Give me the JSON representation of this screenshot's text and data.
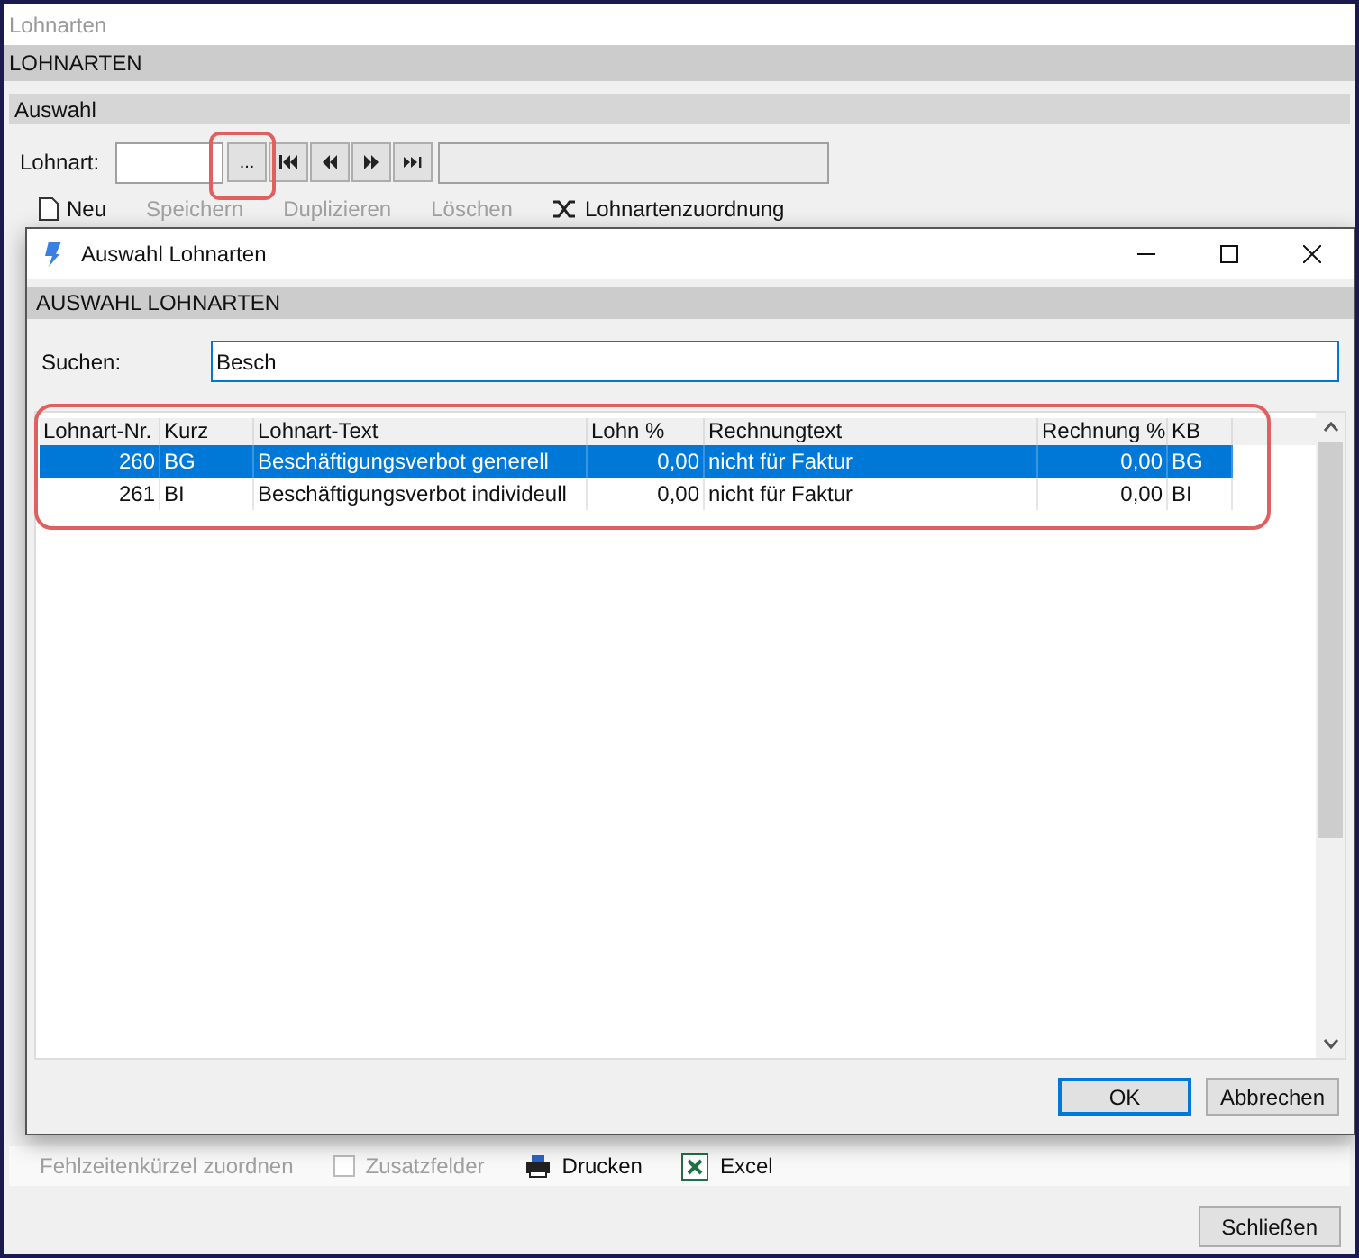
{
  "window": {
    "title": "Lohnarten",
    "header": "LOHNARTEN"
  },
  "selection": {
    "title": "Auswahl",
    "label": "Lohnart:",
    "browse_button": "..."
  },
  "toolbar": [
    {
      "label": "Neu",
      "disabled": false
    },
    {
      "label": "Speichern",
      "disabled": true
    },
    {
      "label": "Duplizieren",
      "disabled": true
    },
    {
      "label": "Löschen",
      "disabled": true
    },
    {
      "label": "Lohnartenzuordnung",
      "disabled": false
    }
  ],
  "dialog": {
    "title": "Auswahl Lohnarten",
    "header": "AUSWAHL LOHNARTEN",
    "search": {
      "label": "Suchen:",
      "value": "Besch"
    },
    "table": {
      "columns": [
        "Lohnart-Nr.",
        "Kurz",
        "Lohnart-Text",
        "Lohn %",
        "Rechnungtext",
        "Rechnung %",
        "KB"
      ],
      "rows": [
        {
          "selected": true,
          "cells": [
            "260",
            "BG",
            "Beschäftigungsverbot generell",
            "0,00",
            "nicht für Faktur",
            "0,00",
            "BG"
          ]
        },
        {
          "selected": false,
          "cells": [
            "261",
            "BI",
            "Beschäftigungsverbot individeull",
            "0,00",
            "nicht für Faktur",
            "0,00",
            "BI"
          ]
        }
      ]
    },
    "buttons": [
      "OK",
      "Abbrechen"
    ]
  },
  "bottom_toolbar": [
    {
      "kind": "plain",
      "label": "Fehlzeitenkürzel zuordnen",
      "disabled": true
    },
    {
      "kind": "checkbox",
      "label": "Zusatzfelder",
      "disabled": true
    },
    {
      "kind": "print",
      "label": "Drucken",
      "disabled": false
    },
    {
      "kind": "excel",
      "label": "Excel",
      "disabled": false
    }
  ],
  "close_button": "Schließen"
}
